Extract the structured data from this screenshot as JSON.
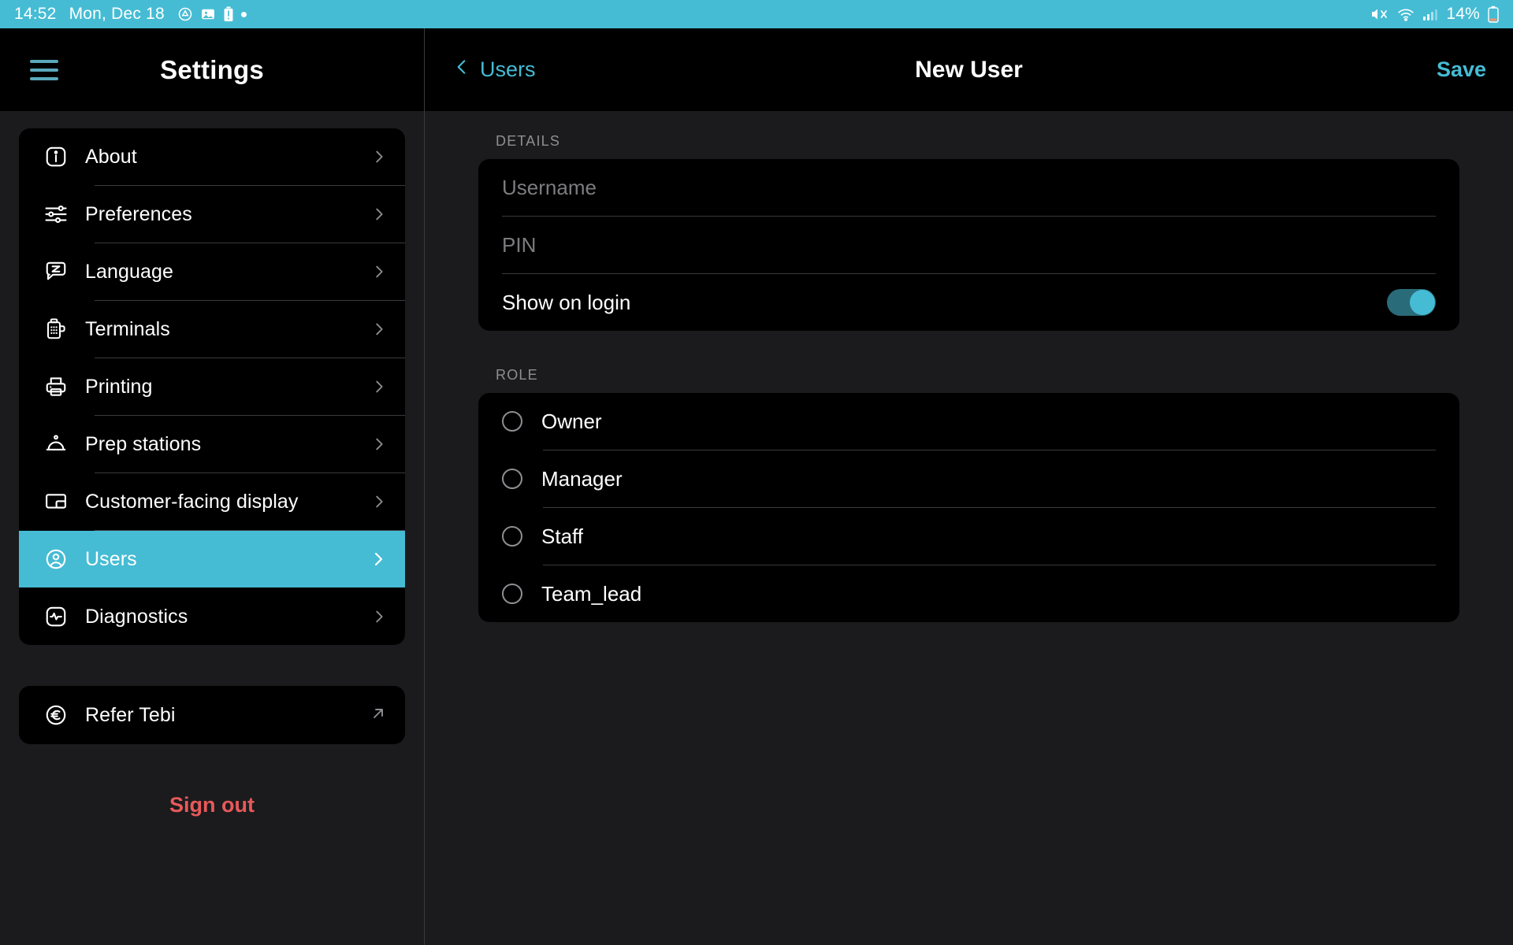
{
  "statusbar": {
    "time": "14:52",
    "date": "Mon, Dec 18",
    "left_icons": [
      "drive-icon",
      "photo-icon",
      "battery-alert-icon",
      "dot-icon"
    ],
    "right_icons": [
      "mute-icon",
      "wifi-icon",
      "cellular-signal-icon"
    ],
    "battery_percent": "14%",
    "battery_icon": "battery-icon",
    "bg_color": "#45bcd4"
  },
  "sidebar": {
    "menu_icon": "hamburger-icon",
    "title": "Settings",
    "items": [
      {
        "label": "About",
        "icon": "info-icon",
        "selected": false
      },
      {
        "label": "Preferences",
        "icon": "sliders-icon",
        "selected": false
      },
      {
        "label": "Language",
        "icon": "translate-icon",
        "selected": false
      },
      {
        "label": "Terminals",
        "icon": "pos-terminal-icon",
        "selected": false
      },
      {
        "label": "Printing",
        "icon": "printer-icon",
        "selected": false
      },
      {
        "label": "Prep stations",
        "icon": "cloche-icon",
        "selected": false
      },
      {
        "label": "Customer-facing display",
        "icon": "display-icon",
        "selected": false
      },
      {
        "label": "Users",
        "icon": "user-circle-icon",
        "selected": true
      },
      {
        "label": "Diagnostics",
        "icon": "pulse-icon",
        "selected": false
      }
    ],
    "refer": {
      "label": "Refer Tebi",
      "icon": "euro-circle-icon",
      "external_icon": "external-link-icon"
    },
    "sign_out": "Sign out",
    "selected_color": "#45bcd4",
    "sign_out_color": "#e8595a"
  },
  "main": {
    "back_label": "Users",
    "back_icon": "chevron-left-icon",
    "title": "New User",
    "save_label": "Save",
    "accent_color": "#45bcd4",
    "details": {
      "section_label": "DETAILS",
      "username": {
        "label": "Username",
        "placeholder": "Username",
        "value": ""
      },
      "pin": {
        "label": "PIN",
        "placeholder": "PIN",
        "value": ""
      },
      "show_on_login": {
        "label": "Show on login",
        "enabled": true
      }
    },
    "role": {
      "section_label": "ROLE",
      "options": [
        {
          "label": "Owner",
          "selected": false
        },
        {
          "label": "Manager",
          "selected": false
        },
        {
          "label": "Staff",
          "selected": false
        },
        {
          "label": "Team_lead",
          "selected": false
        }
      ]
    }
  }
}
